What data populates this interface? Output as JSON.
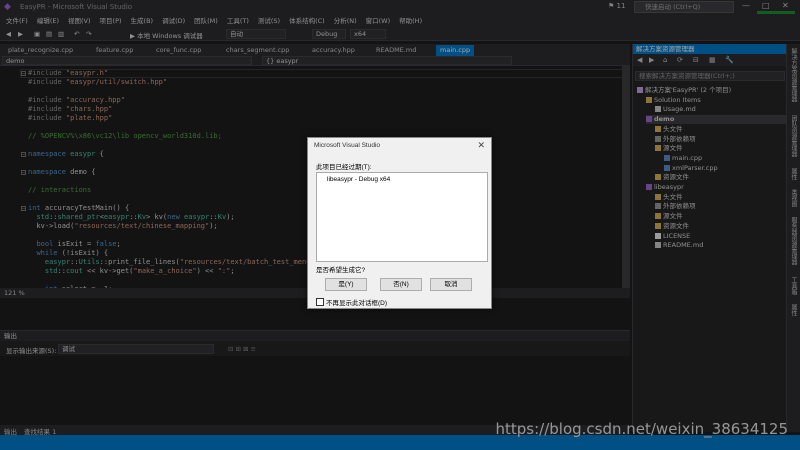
{
  "window": {
    "title": "EasyPR - Microsoft Visual Studio",
    "notification_count": "11",
    "quick_launch_placeholder": "快速启动 (Ctrl+Q)",
    "clock": "20:14"
  },
  "menu": [
    "文件(F)",
    "编辑(E)",
    "视图(V)",
    "项目(P)",
    "生成(B)",
    "调试(D)",
    "团队(M)",
    "工具(T)",
    "测试(S)",
    "体系结构(C)",
    "分析(N)",
    "窗口(W)",
    "帮助(H)"
  ],
  "toolbar": {
    "run_label": "▶ 本地 Windows 调试器",
    "run_mode": "自动",
    "configuration": "Debug",
    "platform": "x64"
  },
  "tabs": [
    "plate_recognize.cpp",
    "feature.cpp",
    "core_func.cpp",
    "chars_segment.cpp",
    "accuracy.hpp",
    "README.md",
    "main.cpp"
  ],
  "active_tab": "main.cpp",
  "navbar": {
    "project": "demo",
    "scope": "{} easypr"
  },
  "code_lines": [
    [
      "#include \"easypr.h\""
    ],
    [
      "#include \"easypr/util/switch.hpp\""
    ],
    [
      ""
    ],
    [
      "#include \"accuracy.hpp\""
    ],
    [
      "#include \"chars.hpp\""
    ],
    [
      "#include \"plate.hpp\""
    ],
    [
      ""
    ],
    [
      "// %OPENCV%\\x86\\vc12\\lib opencv_world310d.lib;"
    ],
    [
      ""
    ],
    [
      "namespace easypr {"
    ],
    [
      ""
    ],
    [
      "namespace demo {"
    ],
    [
      ""
    ],
    [
      "// interactions"
    ],
    [
      ""
    ],
    [
      "int accuracyTestMain() {"
    ],
    [
      "  std::shared_ptr<easypr::Kv> kv(new easypr::Kv);"
    ],
    [
      "  kv->load(\"resources/text/chinese_mapping\");"
    ],
    [
      ""
    ],
    [
      "  bool isExit = false;"
    ],
    [
      "  while (!isExit) {"
    ],
    [
      "    easypr::Utils::print_file_lines(\"resources/text/batch_test_menu\");"
    ],
    [
      "    std::cout << kv->get(\"make_a_choice\") << \":\";"
    ],
    [
      ""
    ],
    [
      "    int select = -1;"
    ]
  ],
  "zoom": "121 %",
  "output": {
    "title": "输出",
    "source_label": "显示输出来源(S):",
    "source_value": "调试"
  },
  "bottom_tabs": [
    "输出",
    "查找结果 1"
  ],
  "solution_explorer": {
    "title": "解决方案资源管理器",
    "search_placeholder": "搜索解决方案资源管理器(Ctrl+;)",
    "nodes": [
      {
        "label": "解决方案'EasyPR' (2 个项目)",
        "depth": 0
      },
      {
        "label": "Solution Items",
        "depth": 1
      },
      {
        "label": "Usage.md",
        "depth": 2
      },
      {
        "label": "demo",
        "depth": 1,
        "bold": true,
        "selected": true
      },
      {
        "label": "头文件",
        "depth": 2
      },
      {
        "label": "外部依赖项",
        "depth": 2
      },
      {
        "label": "源文件",
        "depth": 2
      },
      {
        "label": "main.cpp",
        "depth": 3
      },
      {
        "label": "xmlParser.cpp",
        "depth": 3
      },
      {
        "label": "资源文件",
        "depth": 2
      },
      {
        "label": "libeasypr",
        "depth": 1
      },
      {
        "label": "头文件",
        "depth": 2
      },
      {
        "label": "外部依赖项",
        "depth": 2
      },
      {
        "label": "源文件",
        "depth": 2
      },
      {
        "label": "资源文件",
        "depth": 2
      },
      {
        "label": "LICENSE",
        "depth": 2
      },
      {
        "label": "README.md",
        "depth": 2
      }
    ]
  },
  "side_strip": [
    "解决方案资源管理器",
    "团队资源管理器",
    "属性",
    "类视图",
    "服务器资源管理器",
    "工具箱",
    "属性"
  ],
  "dialog": {
    "title": "Microsoft Visual Studio",
    "outdated_label": "此项目已经过期(T):",
    "outdated_item": "libeasypr - Debug x64",
    "question": "是否希望生成它?",
    "yes": "是(Y)",
    "no": "否(N)",
    "cancel": "取消",
    "dont_show": "不再显示此对话框(D)"
  },
  "watermark": "https://blog.csdn.net/weixin_38634125",
  "colors": {
    "accent": "#007acc",
    "background": "#1e1e1e"
  }
}
